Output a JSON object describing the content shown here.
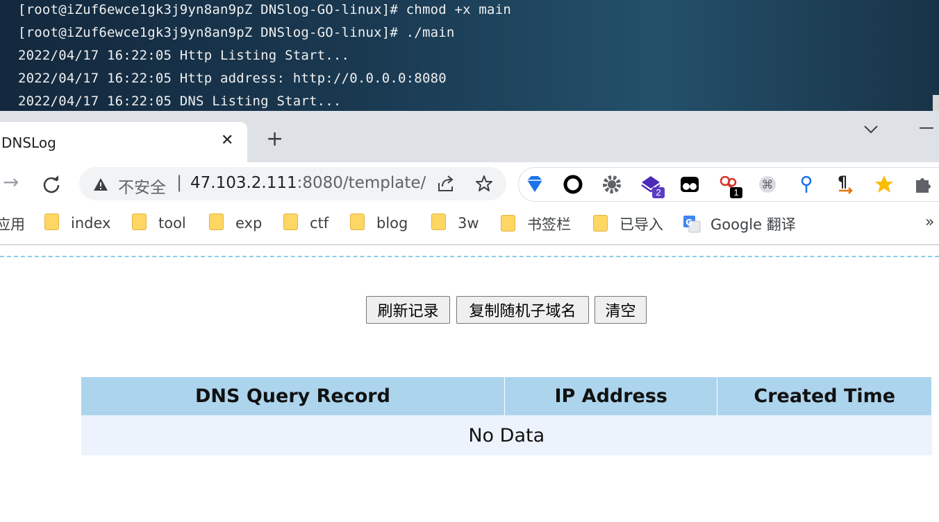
{
  "terminal": {
    "lines": [
      "[root@iZuf6ewce1gk3j9yn8an9pZ DNSlog-GO-linux]# chmod +x main",
      "[root@iZuf6ewce1gk3j9yn8an9pZ DNSlog-GO-linux]# ./main",
      "2022/04/17 16:22:05 Http Listing Start...",
      "2022/04/17 16:22:05 Http address: http://0.0.0.0:8080",
      "2022/04/17 16:22:05 DNS Listing Start..."
    ]
  },
  "browser": {
    "tab": {
      "title": "DNSLog",
      "close": "✕"
    },
    "new_tab": "+",
    "tab_search": "chevron-down",
    "minimize": "—",
    "forward": "→",
    "security_label": "不安全",
    "url_separator": "|",
    "url_host": "47.103.2.111",
    "url_rest": ":8080/template/",
    "extensions": [
      {
        "name": "diamond-extension-icon",
        "color": "#1a73e8"
      },
      {
        "name": "circle-extension-icon",
        "color": "#000000"
      },
      {
        "name": "gear-extension-icon",
        "color": "#5f6368"
      },
      {
        "name": "layers-extension-icon",
        "color": "#4b2bb8",
        "badge": "2",
        "badge_color": "#5b3cc4"
      },
      {
        "name": "tampermonkey-extension-icon",
        "color": "#000000"
      },
      {
        "name": "keys-extension-icon",
        "color": "#d93025",
        "badge": "1",
        "badge_color": "#000000"
      },
      {
        "name": "command-extension-icon",
        "color": "#9aa0a6"
      },
      {
        "name": "pin-extension-icon",
        "color": "#1a73e8"
      },
      {
        "name": "paragraph-extension-icon",
        "color": "#e8710a"
      },
      {
        "name": "star-extension-icon",
        "color": "#fbbc04"
      },
      {
        "name": "puzzle-extension-icon",
        "color": "#5f6368"
      }
    ]
  },
  "bookmarks": {
    "apps_label": "应用",
    "items": [
      {
        "label": "index",
        "type": "folder"
      },
      {
        "label": "tool",
        "type": "folder"
      },
      {
        "label": "exp",
        "type": "folder"
      },
      {
        "label": "ctf",
        "type": "folder"
      },
      {
        "label": "blog",
        "type": "folder"
      },
      {
        "label": "3w",
        "type": "folder"
      },
      {
        "label": "书签栏",
        "type": "folder"
      },
      {
        "label": "已导入",
        "type": "folder"
      },
      {
        "label": "Google 翻译",
        "type": "translate"
      }
    ],
    "more": "»"
  },
  "page": {
    "buttons": {
      "refresh": "刷新记录",
      "copy": "复制随机子域名",
      "clear": "清空"
    },
    "table": {
      "headers": [
        "DNS Query Record",
        "IP Address",
        "Created Time"
      ],
      "empty_text": "No Data"
    }
  }
}
